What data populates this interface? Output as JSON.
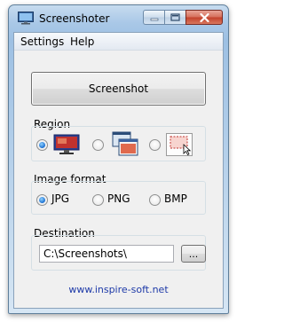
{
  "window": {
    "title": "Screenshoter",
    "icon": "monitor-app-icon"
  },
  "menu": {
    "items": [
      "Settings",
      "Help"
    ]
  },
  "main": {
    "screenshot_label": "Screenshot"
  },
  "region": {
    "label": "Region",
    "options": [
      {
        "icon": "fullscreen-region-icon",
        "selected": true
      },
      {
        "icon": "window-region-icon",
        "selected": false
      },
      {
        "icon": "selection-region-icon",
        "selected": false
      }
    ]
  },
  "format": {
    "label": "Image format",
    "options": [
      "JPG",
      "PNG",
      "BMP"
    ],
    "selected": "JPG"
  },
  "destination": {
    "label": "Destination",
    "value": "C:\\Screenshots\\",
    "browse_label": "..."
  },
  "footer": {
    "link": "www.inspire-soft.net"
  },
  "colors": {
    "link": "#1e3aa8",
    "radio_dot": "#1b6fd1",
    "close_button": "#c2402a"
  }
}
